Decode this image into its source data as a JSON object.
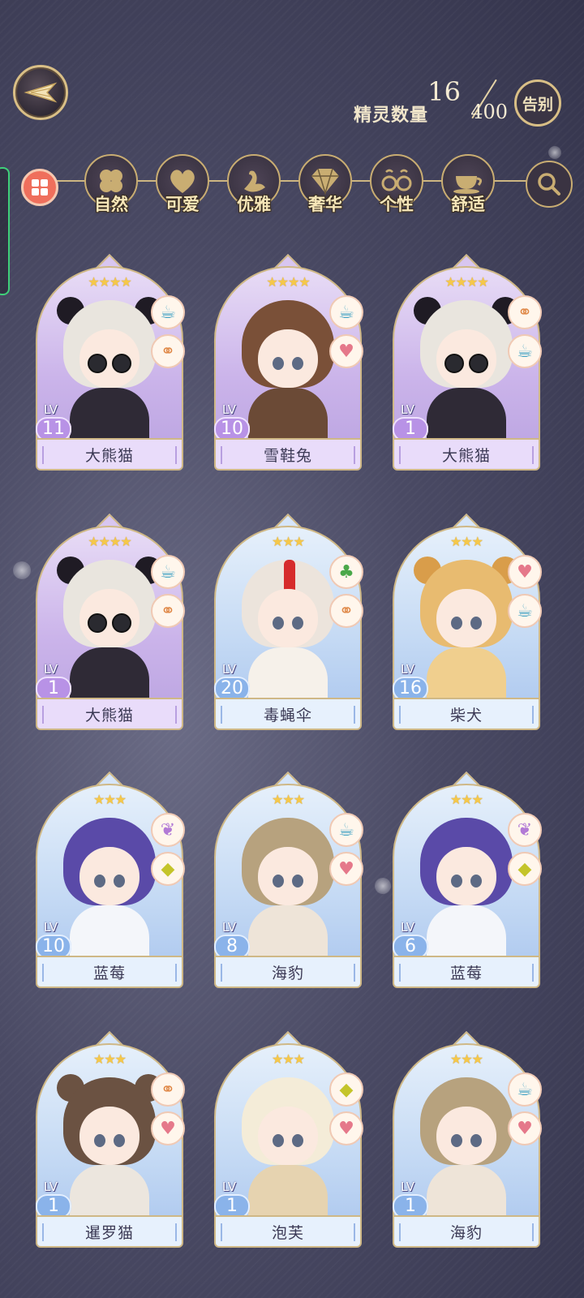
{
  "header": {
    "sprite_count_label": "精灵数量",
    "sprite_count_current": "16",
    "sprite_count_max": "400",
    "farewell_label": "告别"
  },
  "filters": [
    {
      "label": "自然",
      "icon": "clover-icon"
    },
    {
      "label": "可爱",
      "icon": "heart-icon"
    },
    {
      "label": "优雅",
      "icon": "swan-icon"
    },
    {
      "label": "奢华",
      "icon": "diamond-icon"
    },
    {
      "label": "个性",
      "icon": "glasses-icon"
    },
    {
      "label": "舒适",
      "icon": "teacup-icon"
    }
  ],
  "cards": [
    {
      "name": "大熊猫",
      "level": "11",
      "lv_label": "LV",
      "stars": "★★★★",
      "theme": "purple",
      "badges": [
        "teacup-icon",
        "glasses-icon"
      ]
    },
    {
      "name": "雪鞋兔",
      "level": "10",
      "lv_label": "LV",
      "stars": "★★★★",
      "theme": "purple",
      "badges": [
        "teacup-icon",
        "heart-icon"
      ]
    },
    {
      "name": "大熊猫",
      "level": "1",
      "lv_label": "LV",
      "stars": "★★★★",
      "theme": "purple",
      "badges": [
        "glasses-icon",
        "teacup-icon"
      ]
    },
    {
      "name": "大熊猫",
      "level": "1",
      "lv_label": "LV",
      "stars": "★★★★",
      "theme": "purple",
      "badges": [
        "teacup-icon",
        "glasses-icon"
      ]
    },
    {
      "name": "毒蝇伞",
      "level": "20",
      "lv_label": "LV",
      "stars": "★★★",
      "theme": "blue",
      "badges": [
        "clover-icon",
        "glasses-icon"
      ]
    },
    {
      "name": "柴犬",
      "level": "16",
      "lv_label": "LV",
      "stars": "★★★",
      "theme": "blue",
      "badges": [
        "heart-icon",
        "teacup-icon"
      ]
    },
    {
      "name": "蓝莓",
      "level": "10",
      "lv_label": "LV",
      "stars": "★★★",
      "theme": "blue",
      "badges": [
        "swan-icon",
        "diamond-icon"
      ]
    },
    {
      "name": "海豹",
      "level": "8",
      "lv_label": "LV",
      "stars": "★★★",
      "theme": "blue",
      "badges": [
        "teacup-icon",
        "heart-icon"
      ]
    },
    {
      "name": "蓝莓",
      "level": "6",
      "lv_label": "LV",
      "stars": "★★★",
      "theme": "blue",
      "badges": [
        "swan-icon",
        "diamond-icon"
      ]
    },
    {
      "name": "暹罗猫",
      "level": "1",
      "lv_label": "LV",
      "stars": "★★★",
      "theme": "blue",
      "badges": [
        "glasses-icon",
        "heart-icon"
      ]
    },
    {
      "name": "泡芙",
      "level": "1",
      "lv_label": "LV",
      "stars": "★★★",
      "theme": "blue",
      "badges": [
        "diamond-icon",
        "heart-icon"
      ]
    },
    {
      "name": "海豹",
      "level": "1",
      "lv_label": "LV",
      "stars": "★★★",
      "theme": "blue",
      "badges": [
        "teacup-icon",
        "heart-icon"
      ]
    }
  ],
  "colors": {
    "accent_gold": "#d9bf86",
    "purple_card": "#cbb4ea",
    "blue_card": "#c5daf4",
    "star": "#f5c84a"
  }
}
